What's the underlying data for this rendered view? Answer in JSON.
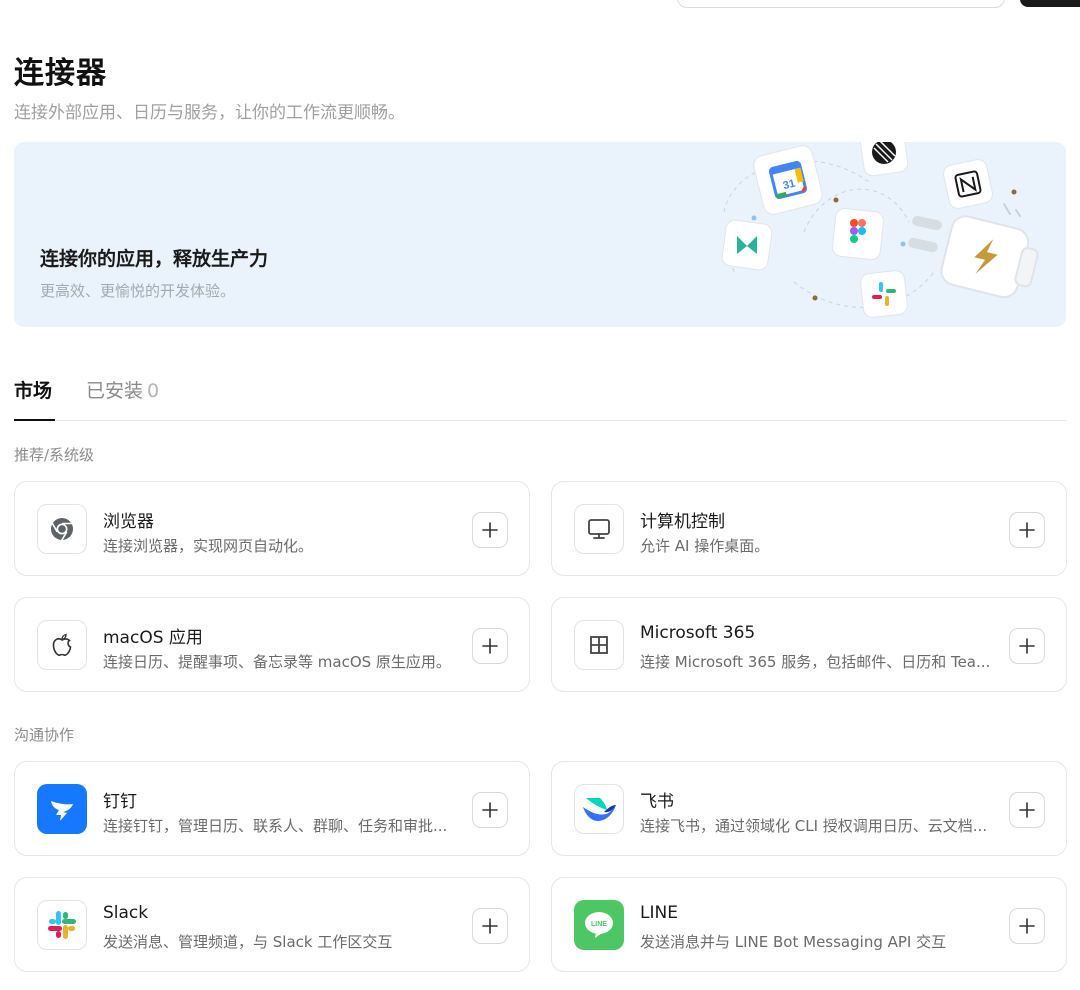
{
  "header": {
    "title": "连接器",
    "subtitle": "连接外部应用、日历与服务，让你的工作流更顺畅。"
  },
  "hero": {
    "title": "连接你的应用，释放生产力",
    "subtitle": "更高效、更愉悦的开发体验。",
    "calendar_day": "31"
  },
  "tabs": {
    "market": "市场",
    "installed": "已安装",
    "installed_count": "0"
  },
  "sections": {
    "recommended": "推荐/系统级",
    "communication": "沟通协作"
  },
  "connectors": {
    "browser": {
      "title": "浏览器",
      "desc": "连接浏览器，实现网页自动化。",
      "icon": "chrome-icon"
    },
    "computer": {
      "title": "计算机控制",
      "desc": "允许 AI 操作桌面。",
      "icon": "monitor-icon"
    },
    "macos": {
      "title": "macOS 应用",
      "desc": "连接日历、提醒事项、备忘录等 macOS 原生应用。",
      "icon": "apple-icon"
    },
    "m365": {
      "title": "Microsoft 365",
      "desc": "连接 Microsoft 365 服务，包括邮件、日历和 Tea...",
      "icon": "windows-grid-icon"
    },
    "dingtalk": {
      "title": "钉钉",
      "desc": "连接钉钉，管理日历、联系人、群聊、任务和审批...",
      "icon": "dingtalk-icon"
    },
    "feishu": {
      "title": "飞书",
      "desc": "连接飞书，通过领域化 CLI 授权调用日历、云文档...",
      "icon": "feishu-icon"
    },
    "slack": {
      "title": "Slack",
      "desc": "发送消息、管理频道，与 Slack 工作区交互",
      "icon": "slack-icon"
    },
    "line": {
      "title": "LINE",
      "desc": "发送消息并与 LINE Bot Messaging API 交互",
      "icon": "line-icon",
      "badge": "LINE"
    }
  },
  "colors": {
    "hero_bg": "#eaf2fb",
    "dingtalk_blue": "#1677ff",
    "line_green": "#4cc764"
  }
}
